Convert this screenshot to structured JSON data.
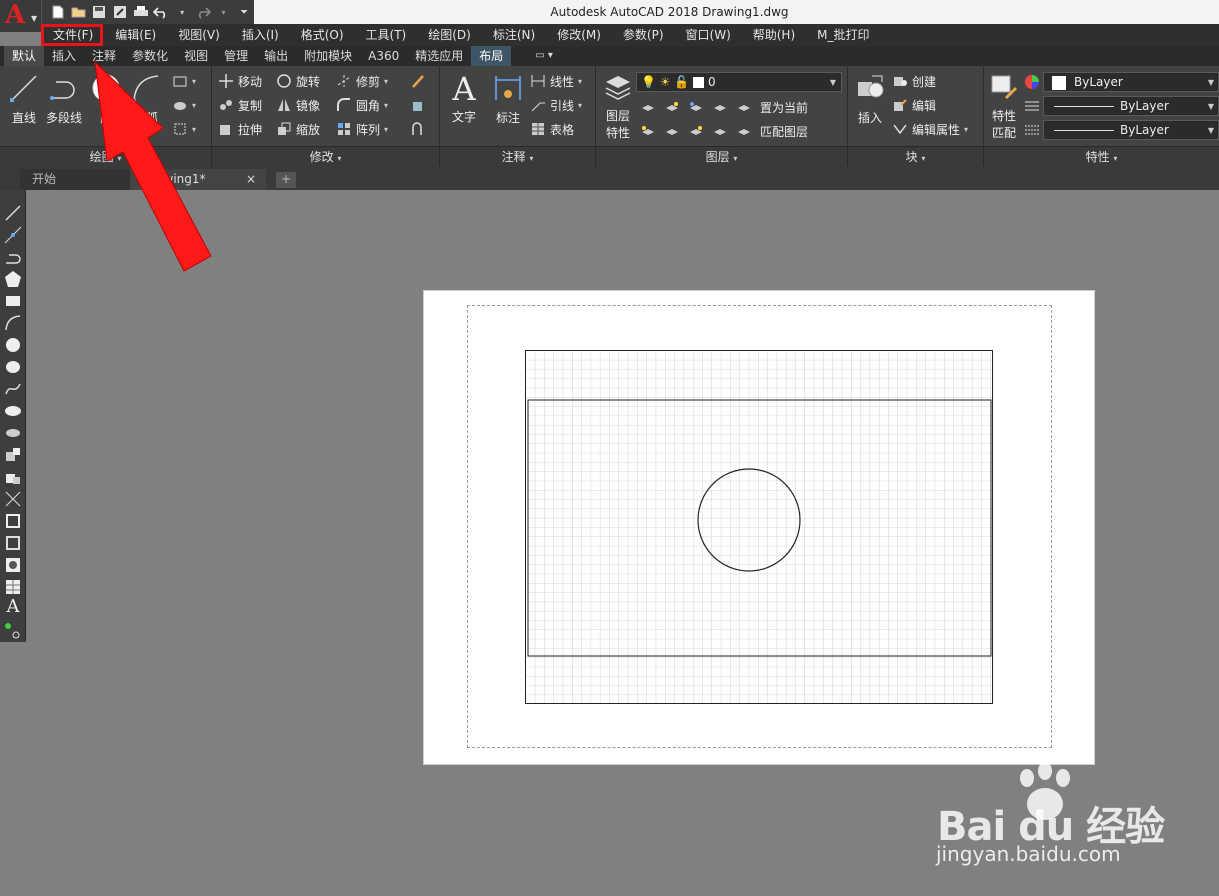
{
  "window": {
    "title": "Autodesk AutoCAD 2018    Drawing1.dwg"
  },
  "menubar": [
    "文件(F)",
    "编辑(E)",
    "视图(V)",
    "插入(I)",
    "格式(O)",
    "工具(T)",
    "绘图(D)",
    "标注(N)",
    "修改(M)",
    "参数(P)",
    "窗口(W)",
    "帮助(H)",
    "M_批打印"
  ],
  "ribbon_tabs": [
    "默认",
    "插入",
    "注释",
    "参数化",
    "视图",
    "管理",
    "输出",
    "附加模块",
    "A360",
    "精选应用",
    "布局"
  ],
  "panels": {
    "draw": {
      "label": "绘图",
      "line": "直线",
      "polyline": "多段线",
      "circle": "圆",
      "arc": "圆弧"
    },
    "modify": {
      "label": "修改",
      "move": "移动",
      "rotate": "旋转",
      "trim": "修剪",
      "copy": "复制",
      "mirror": "镜像",
      "fillet": "圆角",
      "stretch": "拉伸",
      "scale": "缩放",
      "array": "阵列"
    },
    "annotation": {
      "label": "注释",
      "text": "文字",
      "dimension": "标注",
      "leader": "引线",
      "table": "表格",
      "linear": "线性"
    },
    "layers": {
      "label": "图层",
      "properties_l1": "图层",
      "properties_l2": "特性",
      "current_layer": "0",
      "set_current": "置为当前",
      "match_layer": "匹配图层"
    },
    "block": {
      "label": "块",
      "insert": "插入",
      "create": "创建",
      "edit": "编辑",
      "edit_attr": "编辑属性"
    },
    "properties": {
      "label": "特性",
      "match_l1": "特性",
      "match_l2": "匹配",
      "color": "ByLayer",
      "linetype": "ByLayer",
      "lineweight": "ByLayer"
    }
  },
  "file_tabs": {
    "start": "开始",
    "drawing": "Drawing1*",
    "close": "×",
    "new_tab": "+"
  },
  "watermark": {
    "brand": "Bai du 经验",
    "url": "jingyan.baidu.com"
  },
  "colors": {
    "highlight": "#e8141b",
    "arrow": "#ff1a1a",
    "layout_tab": "#3e5566"
  }
}
